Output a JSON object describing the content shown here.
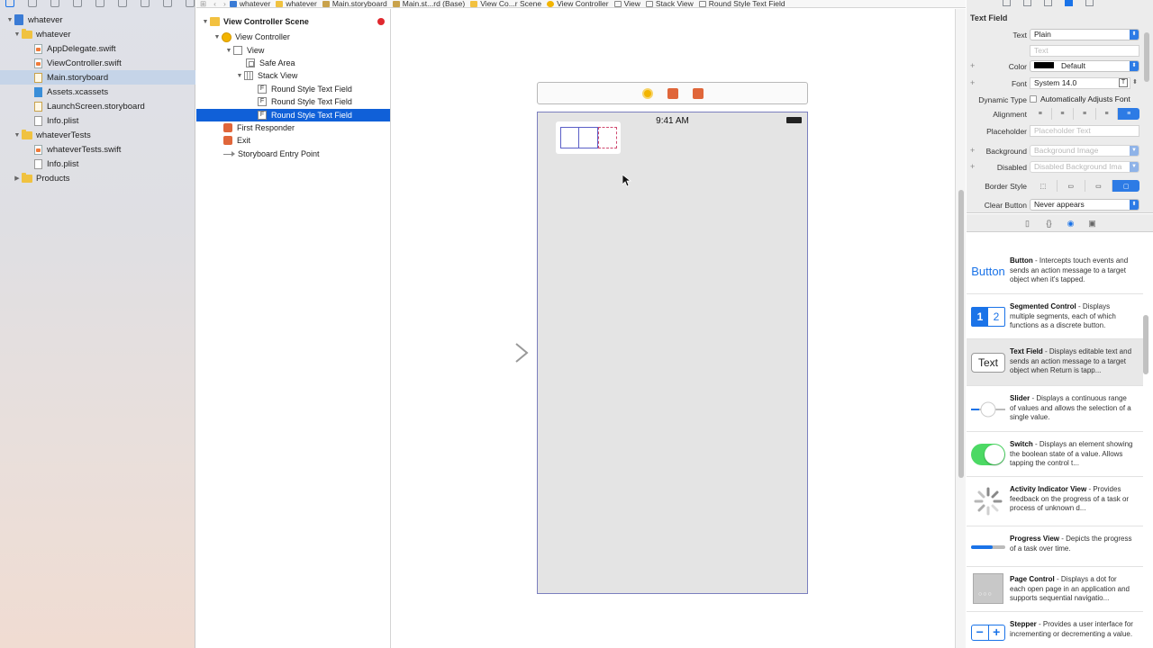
{
  "navigator": {
    "items": [
      {
        "label": "whatever",
        "kind": "project",
        "disclosure": "▼"
      },
      {
        "label": "whatever",
        "kind": "folder",
        "disclosure": "▼"
      },
      {
        "label": "AppDelegate.swift",
        "kind": "swift"
      },
      {
        "label": "ViewController.swift",
        "kind": "swift"
      },
      {
        "label": "Main.storyboard",
        "kind": "storyboard",
        "selected": true
      },
      {
        "label": "Assets.xcassets",
        "kind": "assets"
      },
      {
        "label": "LaunchScreen.storyboard",
        "kind": "storyboard"
      },
      {
        "label": "Info.plist",
        "kind": "plist"
      },
      {
        "label": "whateverTests",
        "kind": "folder",
        "disclosure": "▼"
      },
      {
        "label": "whateverTests.swift",
        "kind": "swift"
      },
      {
        "label": "Info.plist",
        "kind": "plist"
      },
      {
        "label": "Products",
        "kind": "folder",
        "disclosure": "▶"
      }
    ]
  },
  "breadcrumb": [
    "whatever",
    "whatever",
    "Main.storyboard",
    "Main.st...rd (Base)",
    "View Co...r Scene",
    "View Controller",
    "View",
    "Stack View",
    "Round Style Text Field"
  ],
  "outline": {
    "items": [
      {
        "label": "View Controller Scene",
        "disclosure": "▼"
      },
      {
        "label": "View Controller",
        "disclosure": "▼"
      },
      {
        "label": "View",
        "disclosure": "▼"
      },
      {
        "label": "Safe Area"
      },
      {
        "label": "Stack View",
        "disclosure": "▼"
      },
      {
        "label": "Round Style Text Field"
      },
      {
        "label": "Round Style Text Field"
      },
      {
        "label": "Round Style Text Field",
        "selected": true
      },
      {
        "label": "First Responder"
      },
      {
        "label": "Exit"
      },
      {
        "label": "Storyboard Entry Point"
      }
    ]
  },
  "canvas": {
    "status_time": "9:41 AM"
  },
  "inspector": {
    "title": "Text Field",
    "text_label": "Text",
    "text_value": "Plain",
    "text_placeholder": "Text",
    "color_label": "Color",
    "color_value": "Default",
    "font_label": "Font",
    "font_value": "System 14.0",
    "dynamic_type_label": "Dynamic Type",
    "dynamic_type_value": "Automatically Adjusts Font",
    "alignment_label": "Alignment",
    "placeholder_label": "Placeholder",
    "placeholder_value": "Placeholder Text",
    "background_label": "Background",
    "background_value": "Background Image",
    "disabled_label": "Disabled",
    "disabled_value": "Disabled Background Ima",
    "border_style_label": "Border Style",
    "clear_button_label": "Clear Button",
    "clear_button_value": "Never appears"
  },
  "library": {
    "items": [
      {
        "title": "Button",
        "desc": " - Intercepts touch events and sends an action message to a target object when it's tapped.",
        "thumb": "Button"
      },
      {
        "title": "Segmented Control",
        "desc": " - Displays multiple segments, each of which functions as a discrete button.",
        "thumb_a": "1",
        "thumb_b": "2"
      },
      {
        "title": "Text Field",
        "desc": " - Displays editable text and sends an action message to a target object when Return is tapp...",
        "thumb": "Text"
      },
      {
        "title": "Slider",
        "desc": " - Displays a continuous range of values and allows the selection of a single value."
      },
      {
        "title": "Switch",
        "desc": " - Displays an element showing the boolean state of a value. Allows tapping the control t..."
      },
      {
        "title": "Activity Indicator View",
        "desc": " - Provides feedback on the progress of a task or process of unknown d..."
      },
      {
        "title": "Progress View",
        "desc": " - Depicts the progress of a task over time."
      },
      {
        "title": "Page Control",
        "desc": " - Displays a dot for each open page in an application and supports sequential navigatio..."
      },
      {
        "title": "Stepper",
        "desc": " - Provides a user interface for incrementing or decrementing a value."
      }
    ]
  },
  "colors": {
    "selection": "#1060d8",
    "accent": "#2d7be5",
    "device_border": "#7b7fbf"
  }
}
